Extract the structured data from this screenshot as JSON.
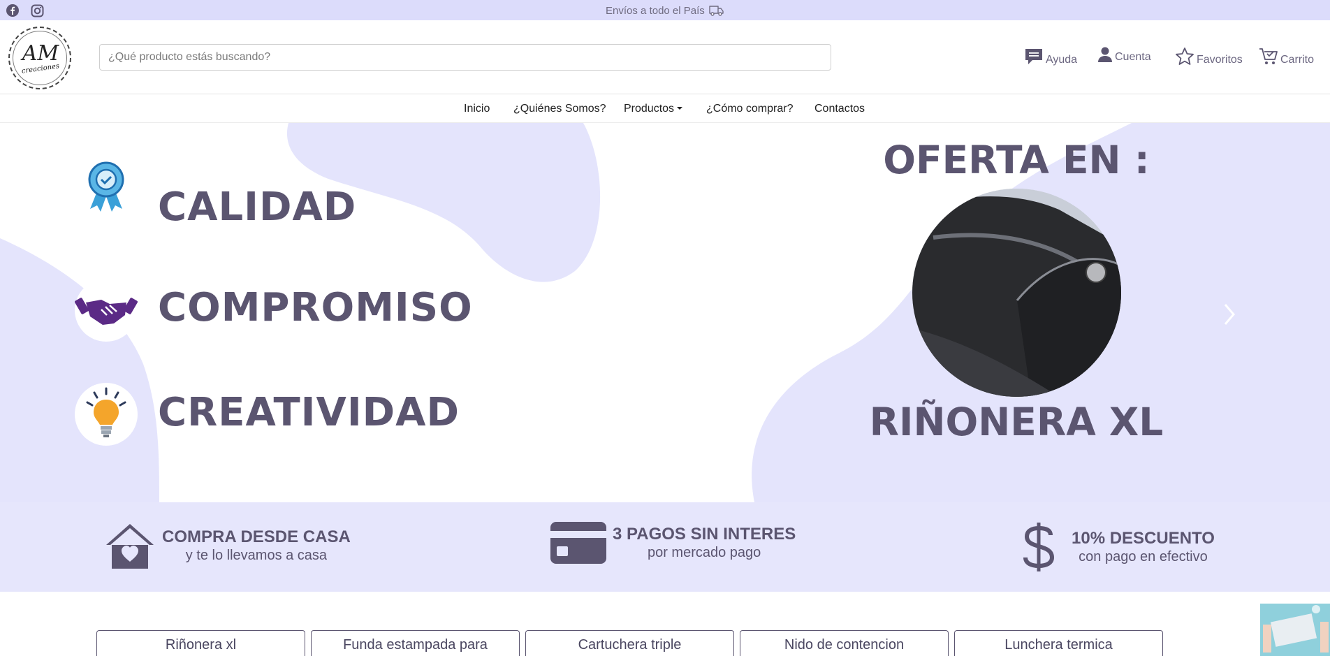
{
  "topbar": {
    "shipping_text": "Envíos a todo el País",
    "social": [
      "facebook-icon",
      "instagram-icon"
    ],
    "background": "#dcdcfb"
  },
  "header": {
    "logo_text": "AM",
    "logo_subtext": "creaciones",
    "search_placeholder": "¿Qué producto estás buscando?",
    "links": {
      "help": "Ayuda",
      "account": "Cuenta",
      "favorites": "Favoritos",
      "cart": "Carrito"
    }
  },
  "nav": {
    "items": [
      "Inicio",
      "¿Quiénes Somos?",
      "Productos",
      "¿Cómo comprar?",
      "Contactos"
    ]
  },
  "hero": {
    "values": [
      "CALIDAD",
      "COMPROMISO",
      "CREATIVIDAD"
    ],
    "value_icons": [
      "quality-badge-icon",
      "handshake-icon",
      "lightbulb-icon"
    ],
    "offer_title": "OFERTA EN :",
    "offer_product": "RIÑONERA XL",
    "text_color": "#5b5570",
    "blob_color": "#e4e4fc"
  },
  "features": [
    {
      "icon": "home-heart-icon",
      "title": "COMPRA DESDE CASA",
      "subtitle": "y te lo llevamos a casa"
    },
    {
      "icon": "credit-card-icon",
      "title": "3 PAGOS SIN INTERES",
      "subtitle": "por mercado pago"
    },
    {
      "icon": "dollar-icon",
      "title": "10% DESCUENTO",
      "subtitle": "con pago en efectivo"
    }
  ],
  "products": [
    "Riñonera xl",
    "Funda estampada para",
    "Cartuchera triple",
    "Nido de contencion",
    "Lunchera termica"
  ]
}
